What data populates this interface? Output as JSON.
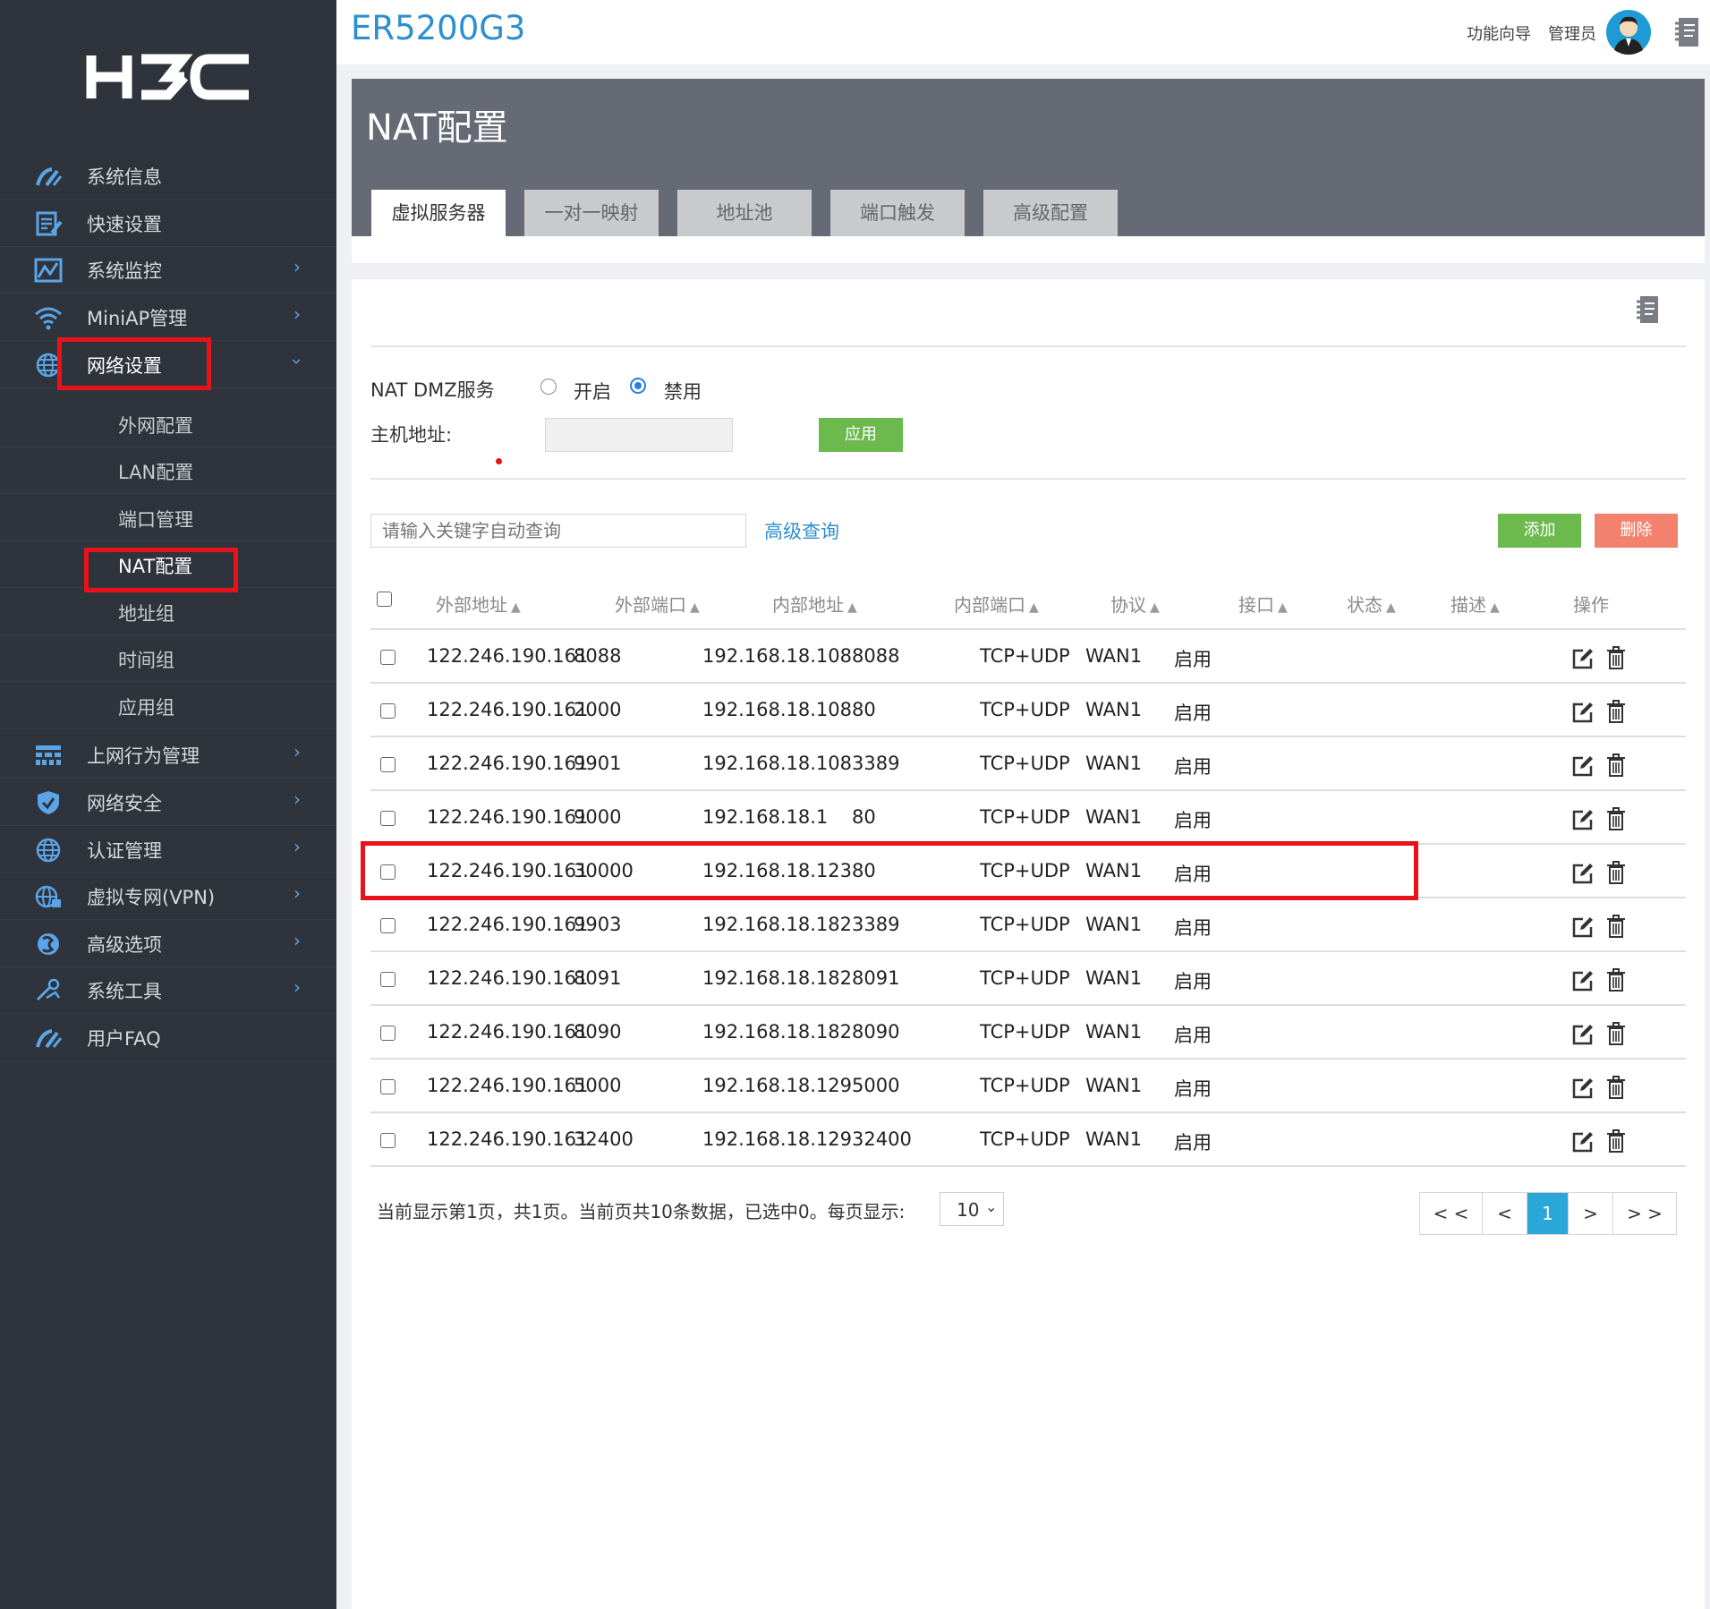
{
  "brand": {
    "logo_text": "H3C",
    "model": "ER5200G3"
  },
  "header": {
    "wizard": "功能向导",
    "admin": "管理员"
  },
  "sidebar": {
    "items": [
      {
        "label": "系统信息",
        "icon": "gauge-icon"
      },
      {
        "label": "快速设置",
        "icon": "quick-setup-icon"
      },
      {
        "label": "系统监控",
        "icon": "monitor-chart-icon"
      },
      {
        "label": "MiniAP管理",
        "icon": "wifi-icon"
      },
      {
        "label": "网络设置",
        "icon": "globe-icon"
      },
      {
        "label": "上网行为管理",
        "icon": "behavior-grid-icon"
      },
      {
        "label": "网络安全",
        "icon": "shield-icon"
      },
      {
        "label": "认证管理",
        "icon": "globe-icon"
      },
      {
        "label": "虚拟专网(VPN)",
        "icon": "vpn-globe-lock-icon"
      },
      {
        "label": "高级选项",
        "icon": "advanced-globe-icon"
      },
      {
        "label": "系统工具",
        "icon": "tools-icon"
      },
      {
        "label": "用户FAQ",
        "icon": "gauge-icon"
      }
    ],
    "subitems": [
      "外网配置",
      "LAN配置",
      "端口管理",
      "NAT配置",
      "地址组",
      "时间组",
      "应用组"
    ]
  },
  "page": {
    "title": "NAT配置",
    "tabs": [
      "虚拟服务器",
      "一对一映射",
      "地址池",
      "端口触发",
      "高级配置"
    ]
  },
  "dmz": {
    "label": "NAT DMZ服务",
    "on_label": "开启",
    "off_label": "禁用",
    "host_label": "主机地址:",
    "apply": "应用"
  },
  "toolbar": {
    "search_placeholder": "请输入关键字自动查询",
    "advanced_search": "高级查询",
    "add": "添加",
    "delete": "删除"
  },
  "table": {
    "columns": [
      "外部地址",
      "外部端口",
      "内部地址",
      "内部端口",
      "协议",
      "接口",
      "状态",
      "描述",
      "操作"
    ],
    "rows": [
      [
        "122.246.190.161",
        "8088",
        "192.168.18.108",
        "8088",
        "TCP+UDP",
        "WAN1",
        "启用"
      ],
      [
        "122.246.190.161",
        "2000",
        "192.168.18.108",
        "80",
        "TCP+UDP",
        "WAN1",
        "启用"
      ],
      [
        "122.246.190.161",
        "9901",
        "192.168.18.108",
        "3389",
        "TCP+UDP",
        "WAN1",
        "启用"
      ],
      [
        "122.246.190.161",
        "9000",
        "192.168.18.1",
        "80",
        "TCP+UDP",
        "WAN1",
        "启用"
      ],
      [
        "122.246.190.161",
        "30000",
        "192.168.18.123",
        "80",
        "TCP+UDP",
        "WAN1",
        "启用"
      ],
      [
        "122.246.190.161",
        "9903",
        "192.168.18.182",
        "3389",
        "TCP+UDP",
        "WAN1",
        "启用"
      ],
      [
        "122.246.190.161",
        "8091",
        "192.168.18.182",
        "8091",
        "TCP+UDP",
        "WAN1",
        "启用"
      ],
      [
        "122.246.190.161",
        "8090",
        "192.168.18.182",
        "8090",
        "TCP+UDP",
        "WAN1",
        "启用"
      ],
      [
        "122.246.190.161",
        "5000",
        "192.168.18.129",
        "5000",
        "TCP+UDP",
        "WAN1",
        "启用"
      ],
      [
        "122.246.190.161",
        "32400",
        "192.168.18.129",
        "32400",
        "TCP+UDP",
        "WAN1",
        "启用"
      ]
    ]
  },
  "footer": {
    "summary": "当前显示第1页，共1页。当前页共10条数据，已选中0。每页显示:",
    "page_size": "10",
    "pagination": [
      "< <",
      "<",
      "1",
      ">",
      "> >"
    ]
  },
  "colors": {
    "sidebar_bg": "#2f333b",
    "accent_blue": "#2e8fcf",
    "highlight_red": "#e8121a",
    "add_green": "#6cb94d",
    "delete_red": "#f4806e"
  }
}
